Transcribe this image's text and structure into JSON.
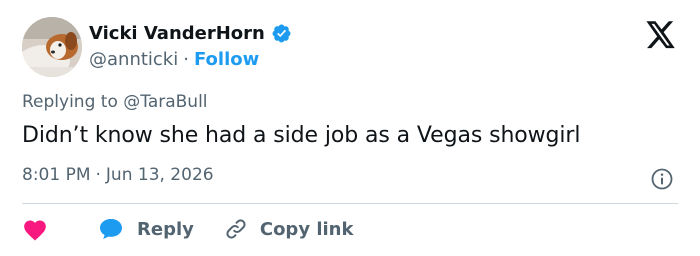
{
  "author": {
    "display_name": "Vicki VanderHorn",
    "handle": "@annticki",
    "separator": "·",
    "follow_label": "Follow",
    "verified_icon": "verified-badge-icon",
    "verified_color": "#1d9bf0"
  },
  "reply_context": {
    "prefix": "Replying to",
    "mention": "@TaraBull"
  },
  "tweet": {
    "text": "Didn’t know she had a side job as a Vegas showgirl",
    "time": "8:01 PM",
    "separator": "·",
    "date": "Jun 13, 2026"
  },
  "actions": {
    "like_icon": "heart-icon",
    "like_color": "#f91880",
    "reply_label": "Reply",
    "reply_icon": "chat-bubble-icon",
    "reply_color": "#1d9bf0",
    "copy_label": "Copy link",
    "copy_icon": "link-icon"
  },
  "icons": {
    "brand": "x-logo-icon",
    "info": "info-icon"
  },
  "colors": {
    "text_primary": "#0f1419",
    "text_secondary": "#536471",
    "accent": "#1d9bf0",
    "divider": "#cfd9de"
  }
}
